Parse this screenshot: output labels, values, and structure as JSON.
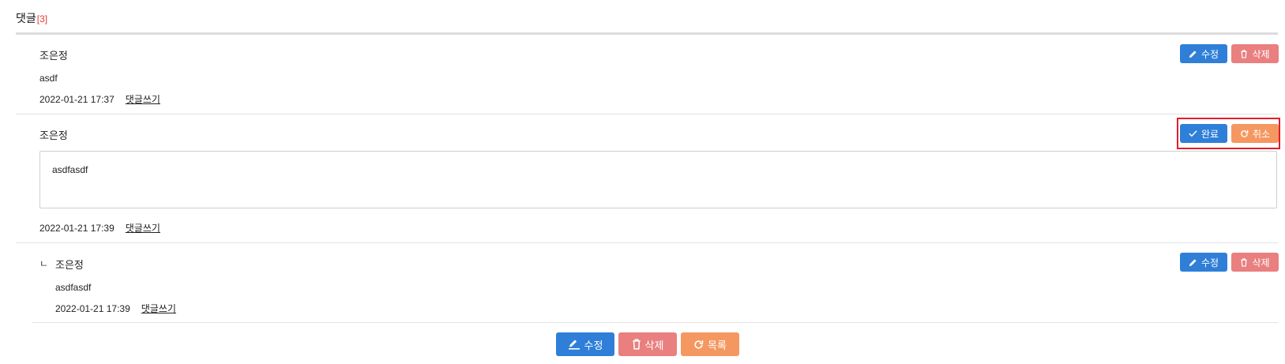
{
  "header": {
    "title": "댓글",
    "count": "[3]"
  },
  "comments": [
    {
      "author": "조은정",
      "content": "asdf",
      "date": "2022-01-21 17:37",
      "reply_link": "댓글쓰기",
      "edit_label": "수정",
      "delete_label": "삭제"
    },
    {
      "author": "조은정",
      "edit_value": "asdfasdf",
      "date": "2022-01-21 17:39",
      "reply_link": "댓글쓰기",
      "done_label": "완료",
      "cancel_label": "취소"
    },
    {
      "reply_marker": "ㄴ",
      "author": "조은정",
      "content": "asdfasdf",
      "date": "2022-01-21 17:39",
      "reply_link": "댓글쓰기",
      "edit_label": "수정",
      "delete_label": "삭제"
    }
  ],
  "footer": {
    "edit_label": "수정",
    "delete_label": "삭제",
    "list_label": "목록"
  },
  "colors": {
    "blue": "#2f7fd8",
    "red": "#e97f7f",
    "orange": "#f59760",
    "highlight": "#e11d2a"
  },
  "icons": [
    "pencil-icon",
    "trash-icon",
    "check-icon",
    "refresh-icon"
  ]
}
